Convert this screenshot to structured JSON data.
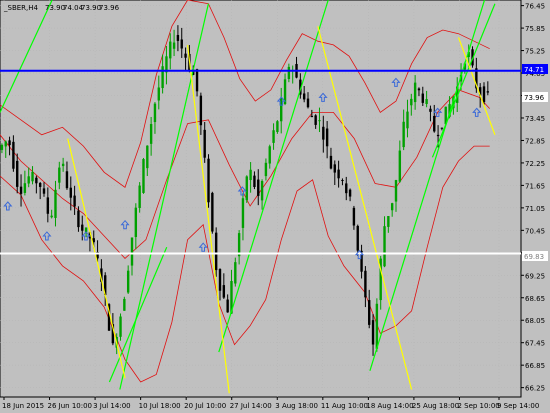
{
  "window": {
    "title": "_SBER,H4",
    "ohlc": [
      "73.90",
      "74.04",
      "73.90",
      "73.96"
    ]
  },
  "price_axis": {
    "ticks": [
      "76.45",
      "75.85",
      "75.25",
      "74.65",
      "74.05",
      "73.45",
      "72.85",
      "72.25",
      "71.65",
      "71.05",
      "70.45",
      "69.85",
      "69.25",
      "68.65",
      "68.05",
      "67.45",
      "66.85",
      "66.25"
    ],
    "labels": {
      "blue_line": "74.71",
      "white_line": "69.83",
      "current_price": "73.96"
    }
  },
  "time_axis": {
    "ticks": [
      "18 Jun 2015",
      "26 Jun 10:00",
      "3 Jul 14:00",
      "10 Jul 18:00",
      "20 Jul 10:00",
      "27 Jul 14:00",
      "3 Aug 18:00",
      "11 Aug 10:00",
      "18 Aug 14:00",
      "25 Aug 18:00",
      "2 Sep 10:00",
      "9 Sep 14:00"
    ]
  },
  "colors": {
    "background": "#c0c0c0",
    "bull_candle": "#00a000",
    "bear_candle": "#000000",
    "bands": "#e01010",
    "trend_up": "#00ff00",
    "trend_down": "#ffff00",
    "level_blue": "#0000ff",
    "level_white": "#ffffff",
    "fractal_arrow": "#3b6ad8"
  },
  "chart_data": {
    "type": "candlestick",
    "symbol": "_SBER",
    "timeframe": "H4",
    "ylim": [
      66.0,
      76.6
    ],
    "horizontal_levels": [
      74.71,
      69.83
    ],
    "last_price": 73.96,
    "price_path": [
      {
        "x": 0,
        "y": 72.6
      },
      {
        "x": 0.02,
        "y": 72.9
      },
      {
        "x": 0.04,
        "y": 71.5
      },
      {
        "x": 0.06,
        "y": 71.9
      },
      {
        "x": 0.08,
        "y": 71.7
      },
      {
        "x": 0.1,
        "y": 70.7
      },
      {
        "x": 0.12,
        "y": 72.4
      },
      {
        "x": 0.14,
        "y": 71.2
      },
      {
        "x": 0.16,
        "y": 70.5
      },
      {
        "x": 0.18,
        "y": 70.2
      },
      {
        "x": 0.2,
        "y": 69.1
      },
      {
        "x": 0.22,
        "y": 67.3
      },
      {
        "x": 0.24,
        "y": 68.5
      },
      {
        "x": 0.26,
        "y": 70.6
      },
      {
        "x": 0.28,
        "y": 72.3
      },
      {
        "x": 0.3,
        "y": 73.8
      },
      {
        "x": 0.32,
        "y": 74.9
      },
      {
        "x": 0.34,
        "y": 75.7
      },
      {
        "x": 0.36,
        "y": 75.1
      },
      {
        "x": 0.38,
        "y": 74.4
      },
      {
        "x": 0.4,
        "y": 71.8
      },
      {
        "x": 0.42,
        "y": 69.3
      },
      {
        "x": 0.44,
        "y": 68.3
      },
      {
        "x": 0.46,
        "y": 70.1
      },
      {
        "x": 0.48,
        "y": 72.2
      },
      {
        "x": 0.5,
        "y": 71.3
      },
      {
        "x": 0.52,
        "y": 72.6
      },
      {
        "x": 0.54,
        "y": 73.6
      },
      {
        "x": 0.56,
        "y": 75.0
      },
      {
        "x": 0.58,
        "y": 74.2
      },
      {
        "x": 0.6,
        "y": 73.5
      },
      {
        "x": 0.62,
        "y": 73.3
      },
      {
        "x": 0.64,
        "y": 72.1
      },
      {
        "x": 0.66,
        "y": 71.9
      },
      {
        "x": 0.68,
        "y": 71.0
      },
      {
        "x": 0.7,
        "y": 69.0
      },
      {
        "x": 0.72,
        "y": 67.4
      },
      {
        "x": 0.74,
        "y": 70.5
      },
      {
        "x": 0.76,
        "y": 71.4
      },
      {
        "x": 0.78,
        "y": 73.4
      },
      {
        "x": 0.8,
        "y": 74.3
      },
      {
        "x": 0.82,
        "y": 73.9
      },
      {
        "x": 0.84,
        "y": 73.0
      },
      {
        "x": 0.86,
        "y": 73.6
      },
      {
        "x": 0.88,
        "y": 74.2
      },
      {
        "x": 0.9,
        "y": 75.3
      },
      {
        "x": 0.92,
        "y": 74.2
      },
      {
        "x": 0.94,
        "y": 73.96
      }
    ],
    "upper_band": [
      {
        "x": 0,
        "y": 73.8
      },
      {
        "x": 0.04,
        "y": 73.4
      },
      {
        "x": 0.08,
        "y": 73.0
      },
      {
        "x": 0.12,
        "y": 73.2
      },
      {
        "x": 0.16,
        "y": 72.7
      },
      {
        "x": 0.2,
        "y": 72.0
      },
      {
        "x": 0.24,
        "y": 71.6
      },
      {
        "x": 0.27,
        "y": 72.8
      },
      {
        "x": 0.3,
        "y": 74.6
      },
      {
        "x": 0.33,
        "y": 75.9
      },
      {
        "x": 0.36,
        "y": 76.6
      },
      {
        "x": 0.4,
        "y": 76.5
      },
      {
        "x": 0.43,
        "y": 75.6
      },
      {
        "x": 0.46,
        "y": 74.5
      },
      {
        "x": 0.49,
        "y": 73.9
      },
      {
        "x": 0.52,
        "y": 74.2
      },
      {
        "x": 0.55,
        "y": 75.0
      },
      {
        "x": 0.58,
        "y": 75.7
      },
      {
        "x": 0.61,
        "y": 75.5
      },
      {
        "x": 0.64,
        "y": 75.4
      },
      {
        "x": 0.67,
        "y": 75.1
      },
      {
        "x": 0.7,
        "y": 74.4
      },
      {
        "x": 0.73,
        "y": 73.6
      },
      {
        "x": 0.76,
        "y": 73.9
      },
      {
        "x": 0.79,
        "y": 74.9
      },
      {
        "x": 0.82,
        "y": 75.6
      },
      {
        "x": 0.85,
        "y": 75.8
      },
      {
        "x": 0.88,
        "y": 75.7
      },
      {
        "x": 0.91,
        "y": 75.5
      },
      {
        "x": 0.94,
        "y": 75.3
      }
    ],
    "middle_band": [
      {
        "x": 0,
        "y": 73.0
      },
      {
        "x": 0.04,
        "y": 72.3
      },
      {
        "x": 0.08,
        "y": 71.8
      },
      {
        "x": 0.12,
        "y": 71.3
      },
      {
        "x": 0.16,
        "y": 70.9
      },
      {
        "x": 0.2,
        "y": 70.3
      },
      {
        "x": 0.24,
        "y": 69.7
      },
      {
        "x": 0.28,
        "y": 70.2
      },
      {
        "x": 0.32,
        "y": 71.8
      },
      {
        "x": 0.36,
        "y": 73.3
      },
      {
        "x": 0.4,
        "y": 73.4
      },
      {
        "x": 0.44,
        "y": 72.2
      },
      {
        "x": 0.48,
        "y": 71.1
      },
      {
        "x": 0.52,
        "y": 71.9
      },
      {
        "x": 0.56,
        "y": 72.9
      },
      {
        "x": 0.6,
        "y": 73.6
      },
      {
        "x": 0.64,
        "y": 73.6
      },
      {
        "x": 0.68,
        "y": 72.9
      },
      {
        "x": 0.72,
        "y": 71.7
      },
      {
        "x": 0.76,
        "y": 71.6
      },
      {
        "x": 0.8,
        "y": 72.4
      },
      {
        "x": 0.84,
        "y": 73.6
      },
      {
        "x": 0.88,
        "y": 74.2
      },
      {
        "x": 0.92,
        "y": 74.0
      },
      {
        "x": 0.94,
        "y": 73.7
      }
    ],
    "lower_band": [
      {
        "x": 0,
        "y": 71.9
      },
      {
        "x": 0.04,
        "y": 71.4
      },
      {
        "x": 0.08,
        "y": 70.2
      },
      {
        "x": 0.12,
        "y": 69.5
      },
      {
        "x": 0.16,
        "y": 69.1
      },
      {
        "x": 0.2,
        "y": 68.4
      },
      {
        "x": 0.24,
        "y": 67.0
      },
      {
        "x": 0.27,
        "y": 66.4
      },
      {
        "x": 0.3,
        "y": 66.6
      },
      {
        "x": 0.33,
        "y": 68.0
      },
      {
        "x": 0.36,
        "y": 70.2
      },
      {
        "x": 0.39,
        "y": 70.6
      },
      {
        "x": 0.42,
        "y": 68.5
      },
      {
        "x": 0.45,
        "y": 67.4
      },
      {
        "x": 0.48,
        "y": 67.9
      },
      {
        "x": 0.51,
        "y": 68.6
      },
      {
        "x": 0.54,
        "y": 70.2
      },
      {
        "x": 0.57,
        "y": 71.5
      },
      {
        "x": 0.6,
        "y": 71.8
      },
      {
        "x": 0.63,
        "y": 70.3
      },
      {
        "x": 0.66,
        "y": 69.5
      },
      {
        "x": 0.7,
        "y": 68.8
      },
      {
        "x": 0.73,
        "y": 67.7
      },
      {
        "x": 0.76,
        "y": 67.9
      },
      {
        "x": 0.79,
        "y": 68.3
      },
      {
        "x": 0.82,
        "y": 70.0
      },
      {
        "x": 0.85,
        "y": 71.6
      },
      {
        "x": 0.88,
        "y": 72.3
      },
      {
        "x": 0.91,
        "y": 72.7
      },
      {
        "x": 0.94,
        "y": 72.7
      }
    ],
    "trend_lines_up": [
      {
        "from": {
          "x": 0,
          "y": 73.6
        },
        "to": {
          "x": 0.1,
          "y": 76.6
        }
      },
      {
        "from": {
          "x": 0.21,
          "y": 66.4
        },
        "to": {
          "x": 0.32,
          "y": 70.0
        }
      },
      {
        "from": {
          "x": 0.23,
          "y": 66.2
        },
        "to": {
          "x": 0.4,
          "y": 76.5
        }
      },
      {
        "from": {
          "x": 0.42,
          "y": 67.2
        },
        "to": {
          "x": 0.63,
          "y": 76.6
        }
      },
      {
        "from": {
          "x": 0.71,
          "y": 66.7
        },
        "to": {
          "x": 0.93,
          "y": 76.6
        }
      },
      {
        "from": {
          "x": 0.83,
          "y": 72.4
        },
        "to": {
          "x": 0.95,
          "y": 76.5
        }
      }
    ],
    "trend_lines_down": [
      {
        "from": {
          "x": 0.13,
          "y": 72.9
        },
        "to": {
          "x": 0.24,
          "y": 66.5
        }
      },
      {
        "from": {
          "x": 0.36,
          "y": 75.4
        },
        "to": {
          "x": 0.44,
          "y": 66.1
        }
      },
      {
        "from": {
          "x": 0.61,
          "y": 75.9
        },
        "to": {
          "x": 0.79,
          "y": 66.2
        }
      },
      {
        "from": {
          "x": 0.88,
          "y": 75.6
        },
        "to": {
          "x": 0.95,
          "y": 73.0
        }
      }
    ],
    "fractal_arrows": [
      {
        "x": 0.015,
        "y": 71.1
      },
      {
        "x": 0.09,
        "y": 70.3
      },
      {
        "x": 0.165,
        "y": 70.3
      },
      {
        "x": 0.24,
        "y": 70.6
      },
      {
        "x": 0.39,
        "y": 70.0
      },
      {
        "x": 0.465,
        "y": 71.5
      },
      {
        "x": 0.54,
        "y": 73.9
      },
      {
        "x": 0.62,
        "y": 74.0
      },
      {
        "x": 0.69,
        "y": 69.8
      },
      {
        "x": 0.76,
        "y": 74.4
      },
      {
        "x": 0.84,
        "y": 73.6
      },
      {
        "x": 0.915,
        "y": 73.6
      }
    ]
  }
}
